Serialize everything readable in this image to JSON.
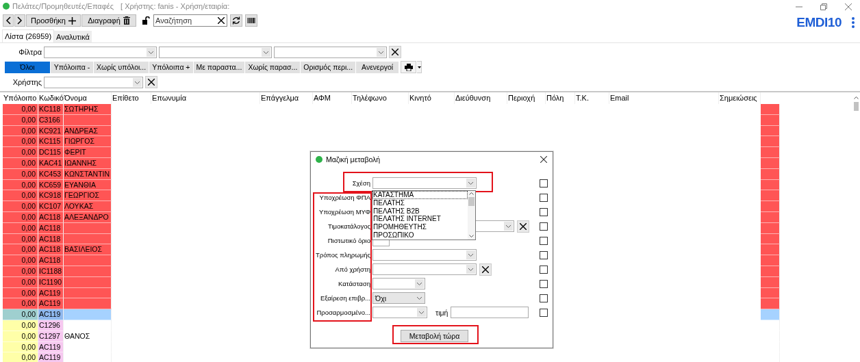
{
  "window": {
    "title": "Πελάτες/Προμηθευτές/Επαφές",
    "subtitle": "[ Χρήστης: fanis - Χρήση/εταιρία:",
    "logo": "EMDI10"
  },
  "toolbar": {
    "add": "Προσθήκη",
    "delete": "Διαγραφή",
    "search": {
      "placeholder": "Αναζήτηση"
    }
  },
  "tabs": [
    {
      "label": "Λίστα (26959)",
      "selected": true
    },
    {
      "label": "Αναλυτικά",
      "selected": false
    }
  ],
  "filter": {
    "label": "Φίλτρα"
  },
  "segments": [
    {
      "label": "Όλοι",
      "selected": true
    },
    {
      "label": "Υπόλοιπα -",
      "selected": false
    },
    {
      "label": "Χωρίς υπόλοι...",
      "selected": false
    },
    {
      "label": "Υπόλοιπα +",
      "selected": false
    },
    {
      "label": "Με παραστα...",
      "selected": false
    },
    {
      "label": "Χωρίς παρασ...",
      "selected": false
    },
    {
      "label": "Ορισμός περι...",
      "selected": false
    },
    {
      "label": "Ανενεργοί",
      "selected": false
    }
  ],
  "user_filter": {
    "label": "Χρήστης"
  },
  "table": {
    "columns": [
      "Υπόλοιπο",
      "Κωδικό",
      "Όνομα",
      "Επίθετο",
      "Επωνυμία",
      "Επάγγελμα",
      "ΑΦΜ",
      "Τηλέφωνο",
      "Κινητό",
      "Διεύθυνση",
      "Περιοχή",
      "Πόλη",
      "Τ.Κ.",
      "Email",
      "Σημειώσεις"
    ],
    "rows": [
      {
        "balance": "0,00",
        "code": "KC118",
        "name": "ΣΩΤΗΡΗΣ",
        "kind": "flagged",
        "selected": false
      },
      {
        "balance": "0,00",
        "code": "C3166",
        "kind": "flagged",
        "selected": false
      },
      {
        "balance": "0,00",
        "code": "KC921",
        "name": "ΑΝΔΡΕΑΣ",
        "kind": "flagged",
        "selected": false
      },
      {
        "balance": "0,00",
        "code": "KC115",
        "name": "ΓΙΩΡΓΟΣ",
        "kind": "flagged",
        "selected": false
      },
      {
        "balance": "0,00",
        "code": "DC115",
        "name": "ΦΕΡΙΤ",
        "kind": "flagged",
        "selected": false
      },
      {
        "balance": "0,00",
        "code": "KAC41",
        "name": "ΙΩΑΝΝΗΣ",
        "kind": "flagged",
        "selected": false
      },
      {
        "balance": "0,00",
        "code": "KC453",
        "name": "ΚΩΝΣΤΑΝΤΙΝ",
        "kind": "flagged",
        "selected": false
      },
      {
        "balance": "0,00",
        "code": "KC659",
        "name": "ΕΥΑΝΘΙΑ",
        "kind": "flagged",
        "selected": false
      },
      {
        "balance": "0,00",
        "code": "KC918",
        "name": "ΓΕΩΡΓΙΟΣ",
        "kind": "flagged",
        "selected": false
      },
      {
        "balance": "0,00",
        "code": "KC107",
        "name": "ΛΟΥΚΑΣ",
        "kind": "flagged",
        "selected": false
      },
      {
        "balance": "0,00",
        "code": "AC118",
        "name": "ΑΛΕΞΑΝΔΡΟ",
        "kind": "flagged",
        "selected": false
      },
      {
        "balance": "0,00",
        "code": "AC118",
        "kind": "flagged",
        "selected": false
      },
      {
        "balance": "0,00",
        "code": "AC118",
        "kind": "flagged",
        "selected": false
      },
      {
        "balance": "0,00",
        "code": "AC118",
        "name": "ΒΑΣΙΛΕΙΟΣ",
        "kind": "flagged",
        "selected": false
      },
      {
        "balance": "0,00",
        "code": "AC118",
        "kind": "flagged",
        "selected": false
      },
      {
        "balance": "0,00",
        "code": "IC1188",
        "kind": "flagged",
        "selected": false
      },
      {
        "balance": "0,00",
        "code": "IC1190",
        "kind": "flagged",
        "selected": false
      },
      {
        "balance": "0,00",
        "code": "AC119",
        "kind": "flagged",
        "selected": false
      },
      {
        "balance": "0,00",
        "code": "AC119",
        "kind": "flagged",
        "selected": false
      },
      {
        "balance": "0,00",
        "code": "AC119",
        "kind": "normal",
        "selected": true
      },
      {
        "balance": "0,00",
        "code": "C1296",
        "kind": "normal",
        "selected": false
      },
      {
        "balance": "0,00",
        "code": "C1297",
        "name": "ΘΑΝΟΣ",
        "kind": "normal",
        "selected": false
      },
      {
        "balance": "0,00",
        "code": "AC119",
        "kind": "normal",
        "selected": false
      },
      {
        "balance": "0,00",
        "code": "AC119",
        "kind": "normal",
        "selected": false
      }
    ]
  },
  "dialog": {
    "title": "Μαζική μεταβολή",
    "fields": [
      {
        "label": "Σχέση",
        "kind": "combo",
        "checked": false
      },
      {
        "label": "Υποχρέωση ΦΠΑ",
        "kind": "covered",
        "checked": false
      },
      {
        "label": "Υποχρέωση ΜΥΦ",
        "kind": "covered",
        "checked": false
      },
      {
        "label": "Τιμοκατάλογος",
        "kind": "combo-clear-wide",
        "checked": false
      },
      {
        "label": "Πιστωτικό όριο",
        "kind": "text-short",
        "checked": false
      },
      {
        "label": "Τρόπος πληρωμής",
        "kind": "combo",
        "checked": false
      },
      {
        "label": "Από χρήστη",
        "kind": "combo-clear",
        "checked": false
      },
      {
        "label": "Κατάσταση",
        "kind": "short-combo",
        "checked": false
      },
      {
        "label": "Εξαίρεση επιβρ...",
        "kind": "short-combo",
        "value": "Όχι",
        "checked": false
      },
      {
        "label": "Προσαρμοσμένο...",
        "kind": "combo-value",
        "value_label": "τιμή",
        "checked": false
      }
    ],
    "dropdown": [
      {
        "label": "ΚΑΤΑΣΤΗΜΑ",
        "selected": true
      },
      {
        "label": "ΠΕΛΑΤΗΣ",
        "selected": false
      },
      {
        "label": "ΠΕΛΑΤΗΣ B2B",
        "selected": false
      },
      {
        "label": "ΠΕΛΑΤΗΣ INTERNET",
        "selected": false
      },
      {
        "label": "ΠΡΟΜΗΘΕΥΤΗΣ",
        "selected": false
      },
      {
        "label": "ΠΡΟΣΩΠΙΚΟ",
        "selected": false
      }
    ],
    "apply": "Μεταβολή τώρα"
  }
}
